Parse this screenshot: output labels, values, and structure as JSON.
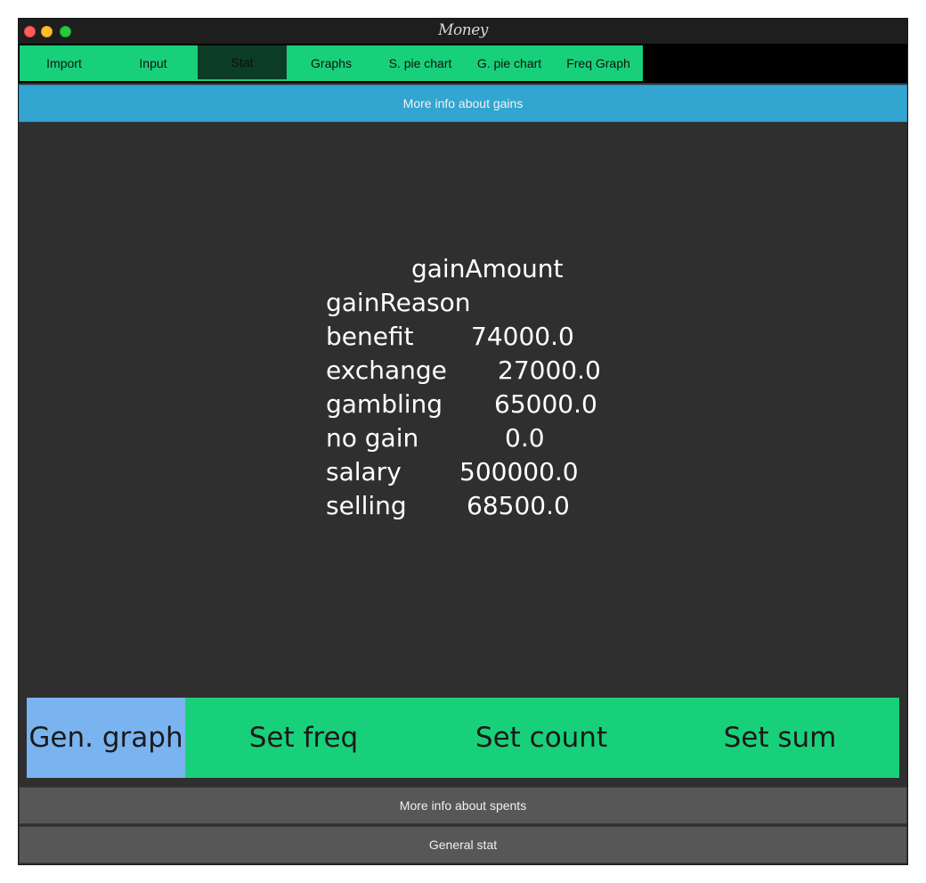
{
  "window": {
    "title": "Money"
  },
  "tabs": [
    {
      "label": "Import",
      "active": false
    },
    {
      "label": "Input",
      "active": false
    },
    {
      "label": "Stat",
      "active": true
    },
    {
      "label": "Graphs",
      "active": false
    },
    {
      "label": "S. pie chart",
      "active": false
    },
    {
      "label": "G. pie chart",
      "active": false
    },
    {
      "label": "Freq Graph",
      "active": false
    }
  ],
  "gains_button": "More info about gains",
  "stats": {
    "column_header": "gainAmount",
    "index_header": "gainReason",
    "rows": [
      {
        "reason": "benefit",
        "amount": "74000.0"
      },
      {
        "reason": "exchange",
        "amount": "27000.0"
      },
      {
        "reason": "gambling",
        "amount": "65000.0"
      },
      {
        "reason": "no gain",
        "amount": "0.0"
      },
      {
        "reason": "salary",
        "amount": "500000.0"
      },
      {
        "reason": "selling",
        "amount": "68500.0"
      }
    ]
  },
  "actions": {
    "gen_graph": "Gen. graph",
    "set_freq": "Set freq",
    "set_count": "Set count",
    "set_sum": "Set sum"
  },
  "spents_button": "More info about spents",
  "general_button": "General stat",
  "colors": {
    "tab_green": "#19d07a",
    "tab_active": "#0b3d24",
    "gains_blue": "#32a5d1",
    "gen_graph_blue": "#7ab4f0",
    "panel_bg": "#2f2f2f",
    "bottom_bar": "#575757"
  }
}
